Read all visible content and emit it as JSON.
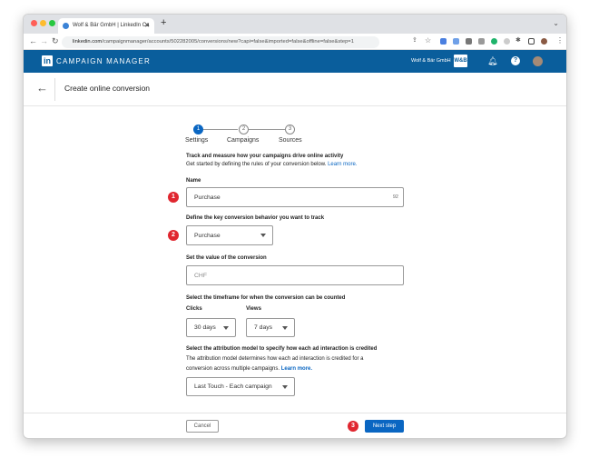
{
  "browser": {
    "tab_title": "Wolf & Bär GmbH | LinkedIn Ca",
    "url_domain": "linkedin.com",
    "url_path": "/campaignmanager/accounts/502282005/conversions/new?capi=false&imported=false&offline=false&step=1"
  },
  "header": {
    "app_name": "CAMPAIGN MANAGER",
    "logo": "in",
    "account_name": "Wolf & Bär GmbH",
    "account_logo": "W&B"
  },
  "page": {
    "title": "Create online conversion"
  },
  "steps": [
    {
      "num": "1",
      "label": "Settings"
    },
    {
      "num": "2",
      "label": "Campaigns"
    },
    {
      "num": "3",
      "label": "Sources"
    }
  ],
  "intro": {
    "heading": "Track and measure how your campaigns drive online activity",
    "text": "Get started by defining the rules of your conversion below.",
    "link": "Learn more."
  },
  "form": {
    "name_label": "Name",
    "name_value": "Purchase",
    "name_counter": "92",
    "behavior_label": "Define the key conversion behavior you want to track",
    "behavior_value": "Purchase",
    "value_label": "Set the value of the conversion",
    "value_placeholder": "CHF",
    "timeframe_label": "Select the timeframe for when the conversion can be counted",
    "clicks_label": "Clicks",
    "clicks_value": "30 days",
    "views_label": "Views",
    "views_value": "7 days",
    "attribution_label": "Select the attribution model to specify how each ad interaction is credited",
    "attribution_desc1": "The attribution model determines how each ad interaction is credited for a",
    "attribution_desc2": "conversion across multiple campaigns.",
    "attribution_link": "Learn more.",
    "attribution_value": "Last Touch - Each campaign"
  },
  "footer": {
    "cancel": "Cancel",
    "next": "Next step"
  },
  "annotations": [
    "1",
    "2",
    "3"
  ]
}
